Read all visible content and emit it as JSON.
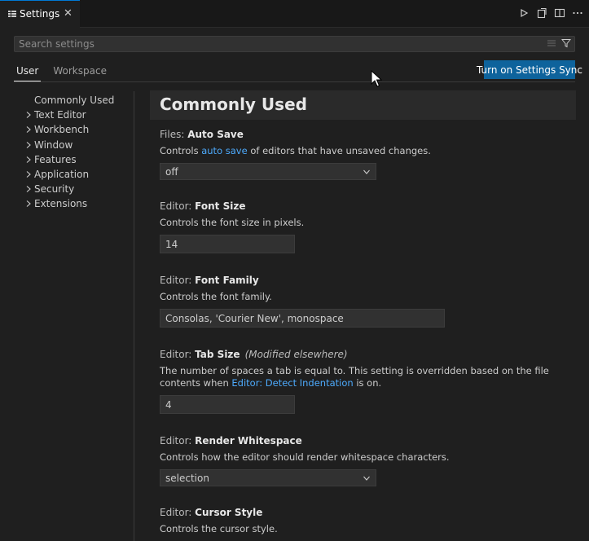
{
  "tab": {
    "label": "Settings",
    "close": "✕"
  },
  "search": {
    "placeholder": "Search settings",
    "value": ""
  },
  "scope": {
    "user": "User",
    "workspace": "Workspace"
  },
  "sync_button": "Turn on Settings Sync",
  "toc": {
    "items": [
      {
        "label": "Commonly Used",
        "expandable": false
      },
      {
        "label": "Text Editor",
        "expandable": true
      },
      {
        "label": "Workbench",
        "expandable": true
      },
      {
        "label": "Window",
        "expandable": true
      },
      {
        "label": "Features",
        "expandable": true
      },
      {
        "label": "Application",
        "expandable": true
      },
      {
        "label": "Security",
        "expandable": true
      },
      {
        "label": "Extensions",
        "expandable": true
      }
    ]
  },
  "content": {
    "section_title": "Commonly Used",
    "settings": {
      "auto_save": {
        "category": "Files: ",
        "name": "Auto Save",
        "desc_before": "Controls ",
        "desc_link": "auto save",
        "desc_after": " of editors that have unsaved changes.",
        "value": "off"
      },
      "font_size": {
        "category": "Editor: ",
        "name": "Font Size",
        "desc": "Controls the font size in pixels.",
        "value": "14"
      },
      "font_family": {
        "category": "Editor: ",
        "name": "Font Family",
        "desc": "Controls the font family.",
        "value": "Consolas, 'Courier New', monospace"
      },
      "tab_size": {
        "category": "Editor: ",
        "name": "Tab Size",
        "modified": "(Modified elsewhere)",
        "desc_before": "The number of spaces a tab is equal to. This setting is overridden based on the file contents when ",
        "desc_link": "Editor: Detect Indentation",
        "desc_after": " is on.",
        "value": "4"
      },
      "render_whitespace": {
        "category": "Editor: ",
        "name": "Render Whitespace",
        "desc": "Controls how the editor should render whitespace characters.",
        "value": "selection"
      },
      "cursor_style": {
        "category": "Editor: ",
        "name": "Cursor Style",
        "desc": "Controls the cursor style."
      }
    }
  },
  "colors": {
    "accent": "#0e639c",
    "link": "#4daafc",
    "background": "#1f1f1f"
  },
  "icons": [
    "settings-file-icon",
    "close-icon",
    "run-icon",
    "open-json-icon",
    "split-editor-icon",
    "more-actions-icon",
    "clear-filter-icon",
    "filter-icon",
    "chevron-right-icon",
    "chevron-down-icon",
    "mouse-cursor-icon"
  ]
}
